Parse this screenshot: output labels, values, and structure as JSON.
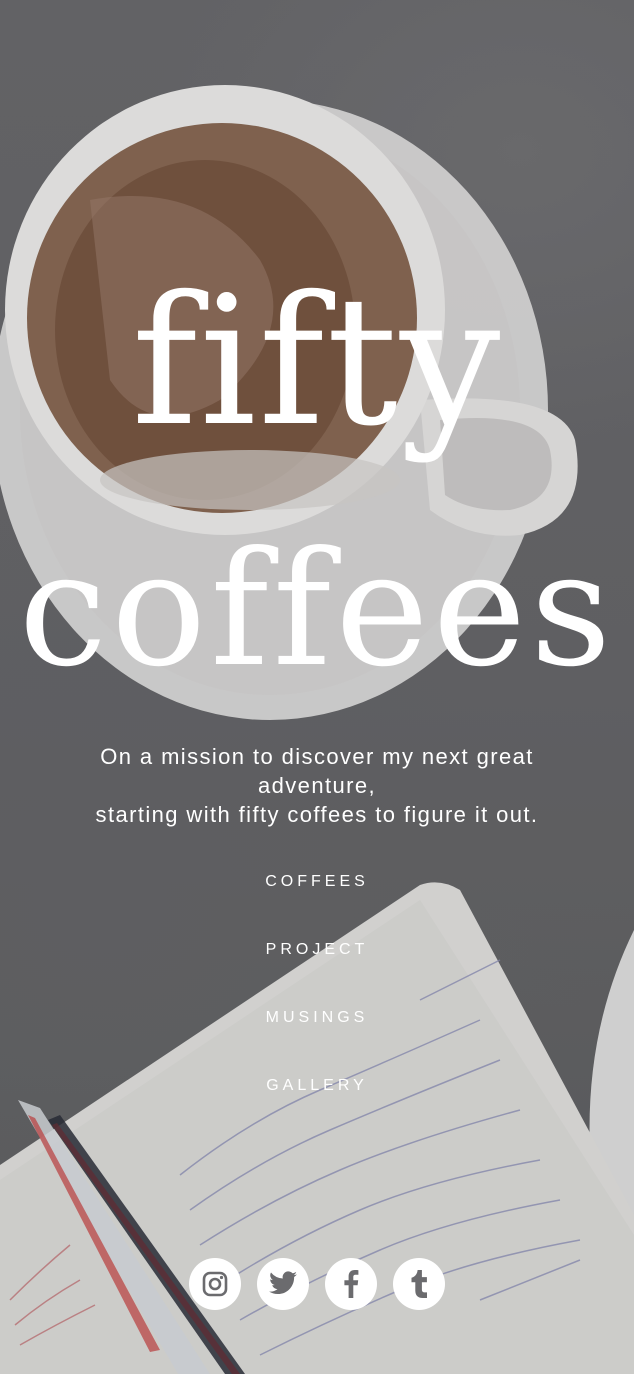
{
  "hero": {
    "title_line1": "fifty",
    "title_line2": "coffees",
    "tagline_line1": "On a mission to discover my next great",
    "tagline_line2": "adventure,",
    "tagline_line3": "starting with fifty coffees to figure it out."
  },
  "nav": {
    "items": [
      {
        "label": "COFFEES"
      },
      {
        "label": "PROJECT"
      },
      {
        "label": "MUSINGS"
      },
      {
        "label": "GALLERY"
      }
    ]
  },
  "social": {
    "icons": [
      "instagram-icon",
      "twitter-icon",
      "facebook-icon",
      "tumblr-icon"
    ],
    "icon_color": "#6b6b6e",
    "button_color": "#ffffff"
  },
  "colors": {
    "text": "#ffffff",
    "background": "#6a6a6c"
  }
}
